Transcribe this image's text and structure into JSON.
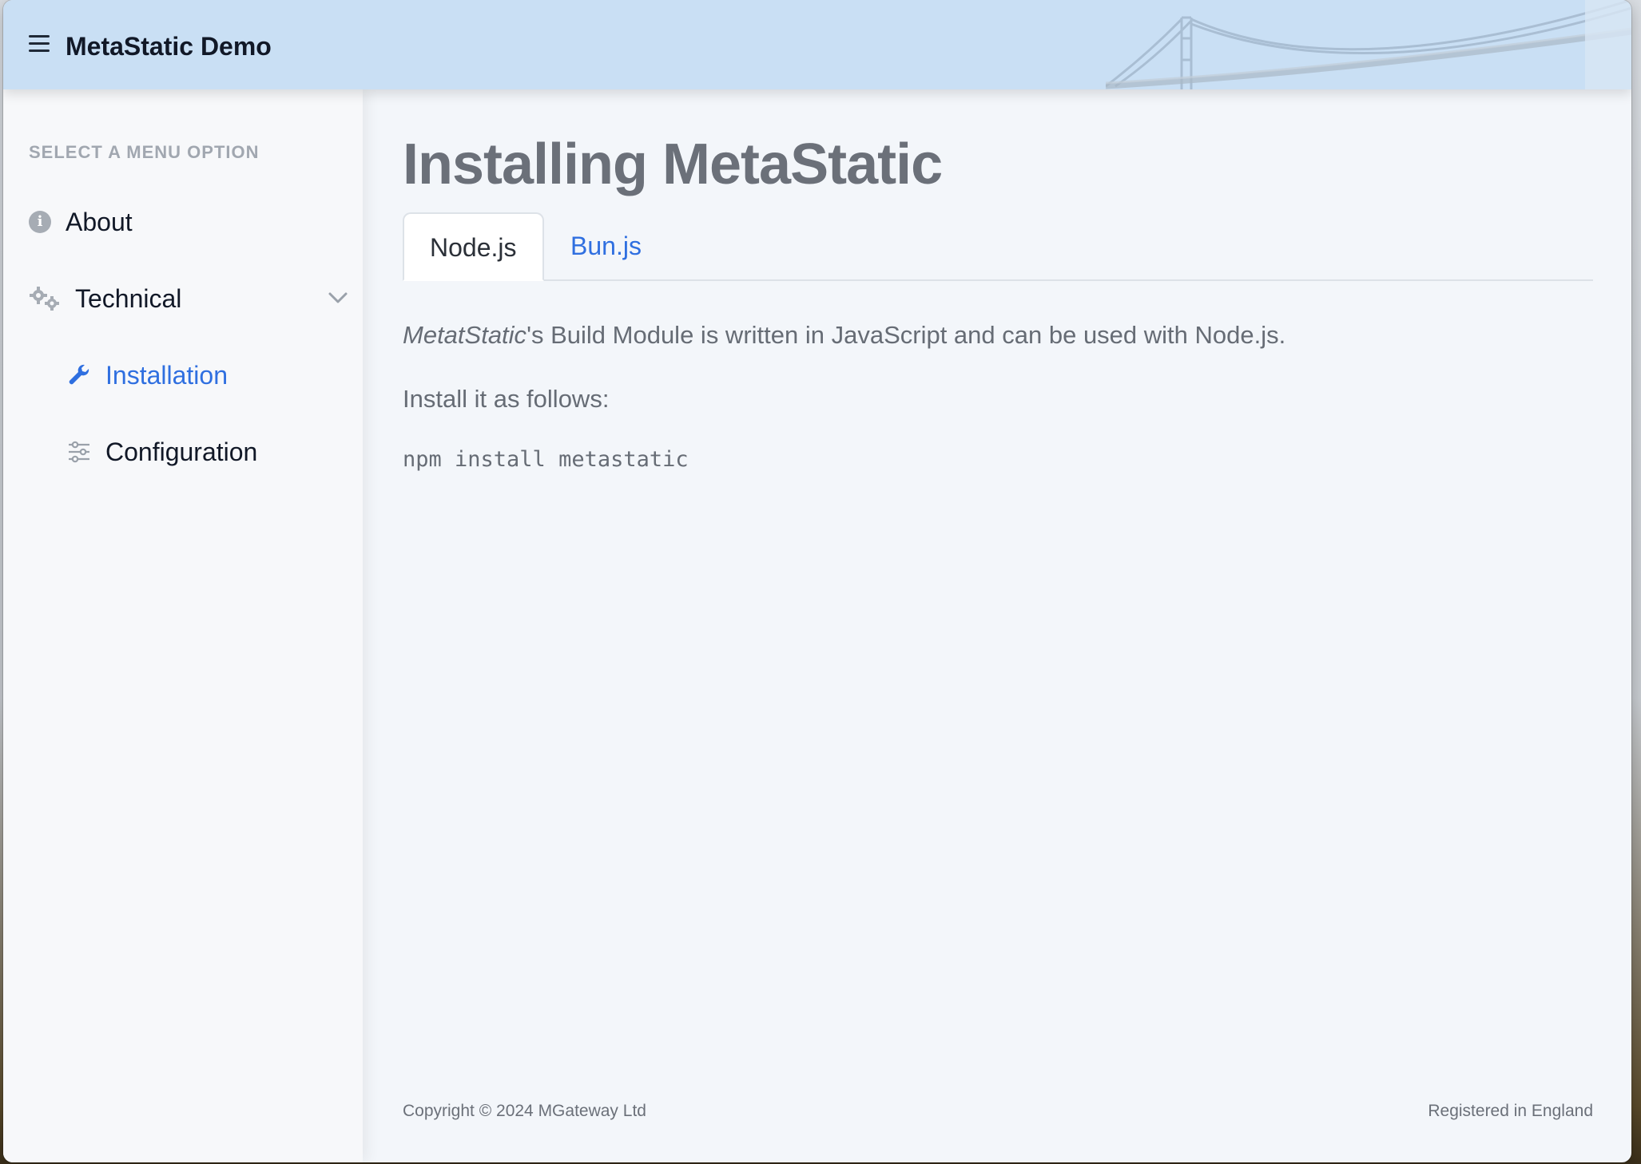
{
  "header": {
    "app_title": "MetaStatic Demo"
  },
  "sidebar": {
    "section_label": "SELECT A MENU OPTION",
    "items": [
      {
        "label": "About",
        "icon": "info-icon"
      },
      {
        "label": "Technical",
        "icon": "gears-icon",
        "expanded": true
      },
      {
        "label": "Installation",
        "icon": "wrench-icon",
        "active": true
      },
      {
        "label": "Configuration",
        "icon": "sliders-icon"
      }
    ]
  },
  "main": {
    "title": "Installing MetaStatic",
    "tabs": [
      {
        "label": "Node.js",
        "selected": true
      },
      {
        "label": "Bun.js",
        "selected": false
      }
    ],
    "paragraph1": {
      "emphasis": "MetatStatic",
      "rest": "'s Build Module is written in JavaScript and can be used with Node.js."
    },
    "paragraph2": "Install it as follows:",
    "code": "npm install metastatic"
  },
  "footer": {
    "copyright": "Copyright © 2024 MGateway Ltd",
    "registration": "Registered in England"
  },
  "colors": {
    "header_bg": "#c9dff4",
    "accent": "#2f6fe0",
    "sidebar_bg": "#f7f8fa",
    "content_bg": "#f3f6fa"
  }
}
